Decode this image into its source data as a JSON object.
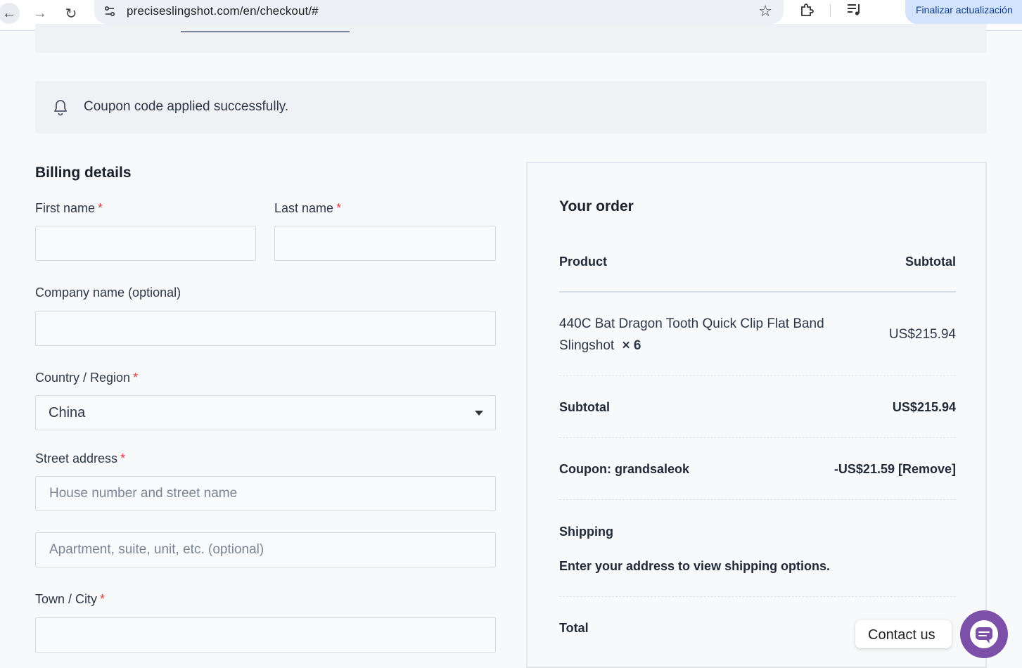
{
  "browser": {
    "url": "preciseslingshot.com/en/checkout/#",
    "update_button": "Finalizar actualización"
  },
  "notice": {
    "message": "Coupon code applied successfully."
  },
  "billing": {
    "title": "Billing details",
    "first_name_label": "First name",
    "last_name_label": "Last name",
    "company_label": "Company name (optional)",
    "country_label": "Country / Region",
    "country_value": "China",
    "street_label": "Street address",
    "street_placeholder": "House number and street name",
    "apartment_placeholder": "Apartment, suite, unit, etc. (optional)",
    "city_label": "Town / City",
    "required_mark": "*"
  },
  "order": {
    "title": "Your order",
    "col_product": "Product",
    "col_subtotal": "Subtotal",
    "item_name": "440C Bat Dragon Tooth Quick Clip Flat Band Slingshot",
    "item_qty": "× 6",
    "item_price": "US$215.94",
    "subtotal_label": "Subtotal",
    "subtotal_value": "US$215.94",
    "coupon_label": "Coupon: grandsaleok",
    "coupon_value": "-US$21.59 [Remove]",
    "shipping_label": "Shipping",
    "shipping_text": "Enter your address to view shipping options.",
    "total_label": "Total"
  },
  "contact": {
    "label": "Contact us"
  },
  "colors": {
    "accent_purple": "#7c4fa8",
    "required_red": "#e53e3e",
    "update_bg": "#d3e3fd"
  }
}
